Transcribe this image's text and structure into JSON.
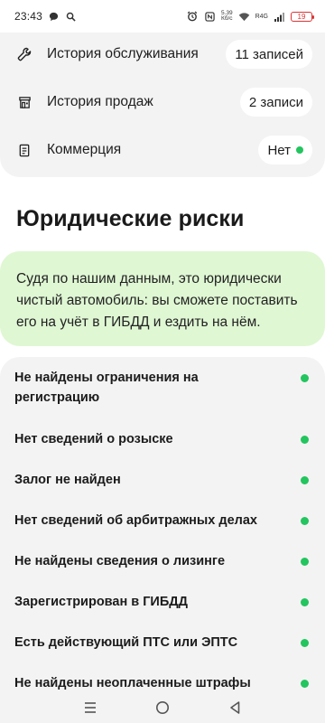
{
  "status_bar": {
    "time": "23:43",
    "net_speed_top": "5.39",
    "net_speed_bottom": "Кб/с",
    "signal_label": "R4G",
    "battery": "19"
  },
  "history": {
    "items": [
      {
        "label": "История обслуживания",
        "value": "11 записей",
        "icon": "wrench-icon"
      },
      {
        "label": "История продаж",
        "value": "2 записи",
        "icon": "storefront-icon"
      },
      {
        "label": "Коммерция",
        "value": "Нет",
        "icon": "document-icon",
        "status_color": "#22c55e"
      }
    ]
  },
  "legal": {
    "title": "Юридические риски",
    "info": "Судя по нашим данным, это юридически чистый автомобиль: вы сможете поставить его на учёт в ГИБДД и ездить на нём.",
    "checks": [
      {
        "label": "Не найдены ограничения на регистрацию"
      },
      {
        "label": "Нет сведений о розыске"
      },
      {
        "label": "Залог не найден"
      },
      {
        "label": "Нет сведений об арбитражных делах"
      },
      {
        "label": "Не найдены сведения о лизинге"
      },
      {
        "label": "Зарегистрирован в ГИБДД"
      },
      {
        "label": "Есть действующий ПТС или ЭПТС"
      },
      {
        "label": "Не найдены неоплаченные штрафы"
      }
    ],
    "ok_color": "#22c55e"
  },
  "nav": {
    "buttons": [
      "menu-nav-icon",
      "home-nav-icon",
      "back-nav-icon"
    ]
  }
}
